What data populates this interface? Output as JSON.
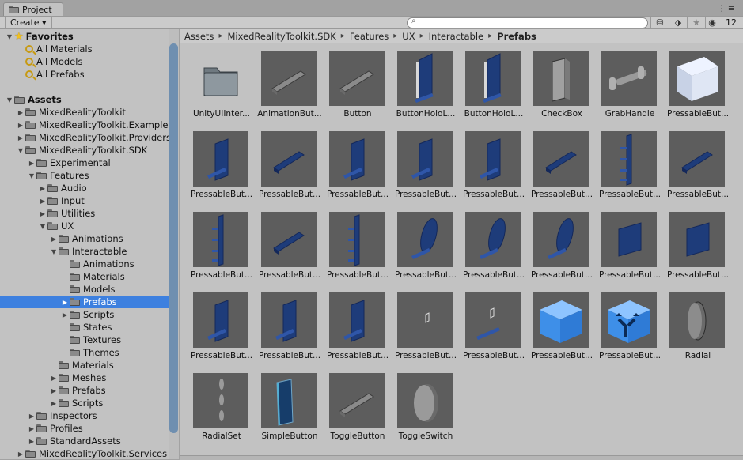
{
  "window": {
    "tab_label": "Project",
    "tab_menu": "⋮≡"
  },
  "toolbar": {
    "create_label": "Create ▾",
    "search_placeholder": "",
    "hidden_count": "12",
    "icons": [
      "create-folder-icon",
      "label-icon",
      "favorite-star-icon",
      "eye-hidden-icon"
    ]
  },
  "tree": [
    {
      "label": "Favorites",
      "level": 0,
      "expander": "open",
      "icon": "star",
      "bold": true
    },
    {
      "label": "All Materials",
      "level": 1,
      "expander": "none",
      "icon": "search"
    },
    {
      "label": "All Models",
      "level": 1,
      "expander": "none",
      "icon": "search"
    },
    {
      "label": "All Prefabs",
      "level": 1,
      "expander": "none",
      "icon": "search"
    },
    {
      "label": "",
      "level": 0,
      "expander": "none",
      "icon": "none",
      "spacer": true
    },
    {
      "label": "Assets",
      "level": 0,
      "expander": "open",
      "icon": "folder",
      "bold": true
    },
    {
      "label": "MixedRealityToolkit",
      "level": 1,
      "expander": "closed",
      "icon": "folder"
    },
    {
      "label": "MixedRealityToolkit.Examples",
      "level": 1,
      "expander": "closed",
      "icon": "folder"
    },
    {
      "label": "MixedRealityToolkit.Providers",
      "level": 1,
      "expander": "closed",
      "icon": "folder"
    },
    {
      "label": "MixedRealityToolkit.SDK",
      "level": 1,
      "expander": "open",
      "icon": "folder"
    },
    {
      "label": "Experimental",
      "level": 2,
      "expander": "closed",
      "icon": "folder"
    },
    {
      "label": "Features",
      "level": 2,
      "expander": "open",
      "icon": "folder"
    },
    {
      "label": "Audio",
      "level": 3,
      "expander": "closed",
      "icon": "folder"
    },
    {
      "label": "Input",
      "level": 3,
      "expander": "closed",
      "icon": "folder"
    },
    {
      "label": "Utilities",
      "level": 3,
      "expander": "closed",
      "icon": "folder"
    },
    {
      "label": "UX",
      "level": 3,
      "expander": "open",
      "icon": "folder"
    },
    {
      "label": "Animations",
      "level": 4,
      "expander": "closed",
      "icon": "folder"
    },
    {
      "label": "Interactable",
      "level": 4,
      "expander": "open",
      "icon": "folder"
    },
    {
      "label": "Animations",
      "level": 5,
      "expander": "none",
      "icon": "folder"
    },
    {
      "label": "Materials",
      "level": 5,
      "expander": "none",
      "icon": "folder"
    },
    {
      "label": "Models",
      "level": 5,
      "expander": "none",
      "icon": "folder"
    },
    {
      "label": "Prefabs",
      "level": 5,
      "expander": "closed",
      "icon": "folder",
      "selected": true
    },
    {
      "label": "Scripts",
      "level": 5,
      "expander": "closed",
      "icon": "folder"
    },
    {
      "label": "States",
      "level": 5,
      "expander": "none",
      "icon": "folder"
    },
    {
      "label": "Textures",
      "level": 5,
      "expander": "none",
      "icon": "folder"
    },
    {
      "label": "Themes",
      "level": 5,
      "expander": "none",
      "icon": "folder"
    },
    {
      "label": "Materials",
      "level": 4,
      "expander": "none",
      "icon": "folder"
    },
    {
      "label": "Meshes",
      "level": 4,
      "expander": "closed",
      "icon": "folder"
    },
    {
      "label": "Prefabs",
      "level": 4,
      "expander": "closed",
      "icon": "folder"
    },
    {
      "label": "Scripts",
      "level": 4,
      "expander": "closed",
      "icon": "folder"
    },
    {
      "label": "Inspectors",
      "level": 2,
      "expander": "closed",
      "icon": "folder"
    },
    {
      "label": "Profiles",
      "level": 2,
      "expander": "closed",
      "icon": "folder"
    },
    {
      "label": "StandardAssets",
      "level": 2,
      "expander": "closed",
      "icon": "folder"
    },
    {
      "label": "MixedRealityToolkit.Services",
      "level": 1,
      "expander": "closed",
      "icon": "folder"
    }
  ],
  "breadcrumb": [
    "Assets",
    "MixedRealityToolkit.SDK",
    "Features",
    "UX",
    "Interactable",
    "Prefabs"
  ],
  "assets": [
    {
      "name": "UnityUIInter...",
      "thumb": "folder"
    },
    {
      "name": "AnimationBut...",
      "thumb": "gray-bar"
    },
    {
      "name": "Button",
      "thumb": "gray-bar"
    },
    {
      "name": "ButtonHoloL...",
      "thumb": "blue-panel"
    },
    {
      "name": "ButtonHoloL...",
      "thumb": "blue-panel"
    },
    {
      "name": "CheckBox",
      "thumb": "gray-slab"
    },
    {
      "name": "GrabHandle",
      "thumb": "handle"
    },
    {
      "name": "PressableBut...",
      "thumb": "white-cube"
    },
    {
      "name": "PressableBut...",
      "thumb": "blue-tall"
    },
    {
      "name": "PressableBut...",
      "thumb": "blue-flat"
    },
    {
      "name": "PressableBut...",
      "thumb": "blue-tall"
    },
    {
      "name": "PressableBut...",
      "thumb": "blue-tall"
    },
    {
      "name": "PressableBut...",
      "thumb": "blue-tall"
    },
    {
      "name": "PressableBut...",
      "thumb": "blue-flat"
    },
    {
      "name": "PressableBut...",
      "thumb": "blue-column"
    },
    {
      "name": "PressableBut...",
      "thumb": "blue-flat"
    },
    {
      "name": "PressableBut...",
      "thumb": "blue-column"
    },
    {
      "name": "PressableBut...",
      "thumb": "blue-flat"
    },
    {
      "name": "PressableBut...",
      "thumb": "blue-column"
    },
    {
      "name": "PressableBut...",
      "thumb": "blue-oval"
    },
    {
      "name": "PressableBut...",
      "thumb": "blue-oval"
    },
    {
      "name": "PressableBut...",
      "thumb": "blue-oval"
    },
    {
      "name": "PressableBut...",
      "thumb": "blue-square"
    },
    {
      "name": "PressableBut...",
      "thumb": "blue-square"
    },
    {
      "name": "PressableBut...",
      "thumb": "blue-tall"
    },
    {
      "name": "PressableBut...",
      "thumb": "blue-tall"
    },
    {
      "name": "PressableBut...",
      "thumb": "blue-tall"
    },
    {
      "name": "PressableBut...",
      "thumb": "tiny-icon"
    },
    {
      "name": "PressableBut...",
      "thumb": "tiny-flat"
    },
    {
      "name": "PressableBut...",
      "thumb": "blue-cube"
    },
    {
      "name": "PressableBut...",
      "thumb": "blue-cube-arrows"
    },
    {
      "name": "Radial",
      "thumb": "radial"
    },
    {
      "name": "RadialSet",
      "thumb": "radialset"
    },
    {
      "name": "SimpleButton",
      "thumb": "simple-button"
    },
    {
      "name": "ToggleButton",
      "thumb": "gray-bar"
    },
    {
      "name": "ToggleSwitch",
      "thumb": "toggle-switch"
    }
  ]
}
